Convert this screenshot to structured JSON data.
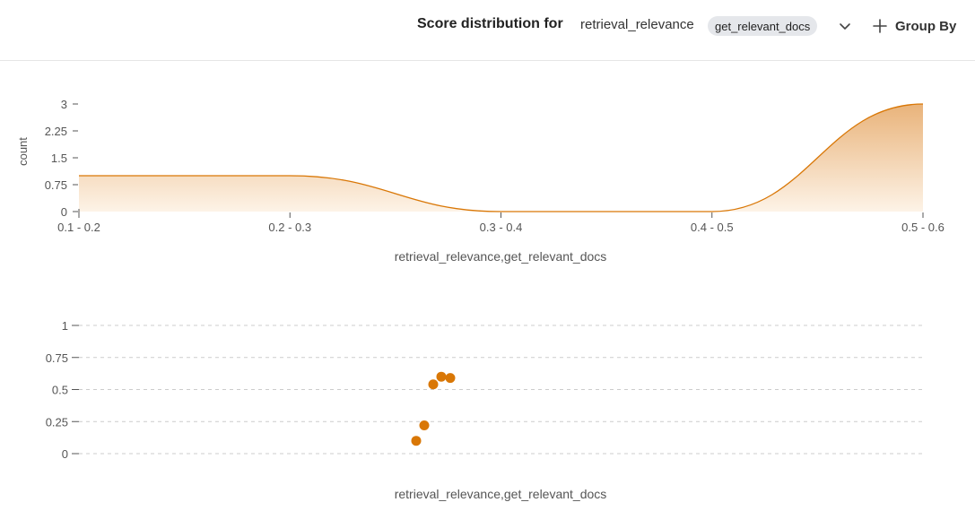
{
  "header": {
    "title": "Score distribution for",
    "metric": "retrieval_relevance",
    "badge": "get_relevant_docs",
    "group_by_label": "Group By",
    "chevron_icon": "chevron-down-icon",
    "plus_icon": "plus-icon"
  },
  "colors": {
    "accent": "#d97706",
    "fill_top": "#e9b37a",
    "fill_bottom": "#fdf3e7",
    "axis_text": "#555555",
    "grid": "#cccccc"
  },
  "chart_data": [
    {
      "type": "area",
      "categories": [
        "0.1 - 0.2",
        "0.2 - 0.3",
        "0.3 - 0.4",
        "0.4 - 0.5",
        "0.5 - 0.6"
      ],
      "values": [
        1,
        1,
        0,
        0,
        3
      ],
      "ylabel": "count",
      "xlabel": "retrieval_relevance,get_relevant_docs",
      "yticks": [
        "0",
        "0.75",
        "1.5",
        "2.25",
        "3"
      ],
      "ylim": [
        0,
        3
      ],
      "grid": false
    },
    {
      "type": "scatter",
      "points": [
        {
          "y": 0.1
        },
        {
          "y": 0.22
        },
        {
          "y": 0.54
        },
        {
          "y": 0.6
        },
        {
          "y": 0.59
        }
      ],
      "xlabel": "retrieval_relevance,get_relevant_docs",
      "yticks": [
        "0",
        "0.25",
        "0.5",
        "0.75",
        "1"
      ],
      "ylim": [
        0,
        1
      ],
      "grid": true
    }
  ]
}
